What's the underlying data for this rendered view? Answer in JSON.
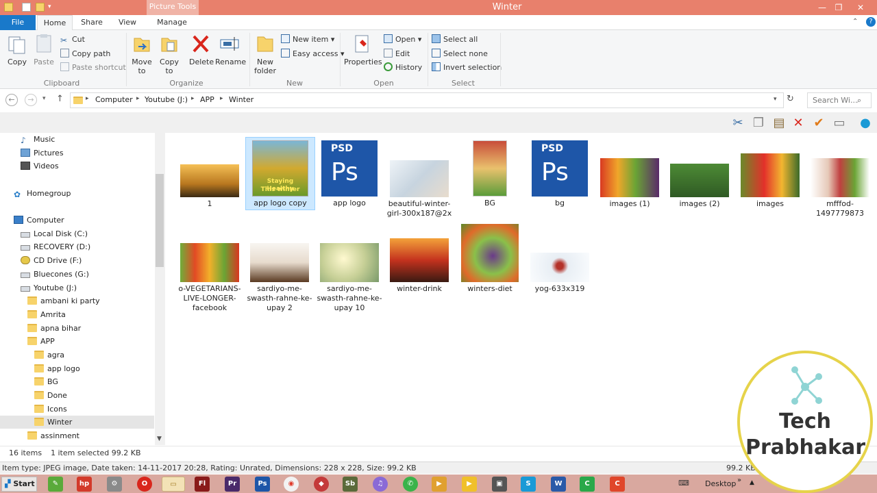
{
  "window": {
    "title": "Winter",
    "picture_tools": "Picture Tools"
  },
  "tabs": [
    "File",
    "Home",
    "Share",
    "View",
    "Manage"
  ],
  "ribbon": {
    "clipboard": {
      "copy": "Copy",
      "paste": "Paste",
      "cut": "Cut",
      "copy_path": "Copy path",
      "paste_shortcut": "Paste shortcut",
      "label": "Clipboard"
    },
    "organize": {
      "move_to": "Move to",
      "copy_to": "Copy to",
      "delete": "Delete",
      "rename": "Rename",
      "label": "Organize"
    },
    "new": {
      "new_folder": "New folder",
      "new_item": "New item",
      "easy_access": "Easy access",
      "label": "New"
    },
    "open": {
      "properties": "Properties",
      "open": "Open",
      "edit": "Edit",
      "history": "History",
      "label": "Open"
    },
    "select": {
      "select_all": "Select all",
      "select_none": "Select none",
      "invert": "Invert selection",
      "label": "Select"
    }
  },
  "address": {
    "crumbs": [
      "Computer",
      "Youtube (J:)",
      "APP",
      "Winter"
    ],
    "search_placeholder": "Search Wi..."
  },
  "nav": {
    "items": [
      "Music",
      "Pictures",
      "Videos",
      "Homegroup",
      "Computer",
      "Local Disk (C:)",
      "RECOVERY (D:)",
      "CD Drive (F:)",
      "Bluecones (G:)",
      "Youtube (J:)",
      "ambani ki party",
      "Amrita",
      "apna bihar",
      "APP",
      "agra",
      "app logo",
      "BG",
      "Done",
      "Icons",
      "Winter",
      "assinment"
    ]
  },
  "files": [
    {
      "name": "1"
    },
    {
      "name": "app logo copy"
    },
    {
      "name": "app logo"
    },
    {
      "name": "beautiful-winter-girl-300x187@2x"
    },
    {
      "name": "BG"
    },
    {
      "name": "bg"
    },
    {
      "name": "images (1)"
    },
    {
      "name": "images (2)"
    },
    {
      "name": "images"
    },
    {
      "name": "mfffod-1497779873"
    },
    {
      "name": "o-VEGETARIANS-LIVE-LONGER-facebook"
    },
    {
      "name": "sardiyo-me-swasth-rahne-ke-upay 2"
    },
    {
      "name": "sardiyo-me-swasth-rahne-ke-upay 10"
    },
    {
      "name": "winter-drink"
    },
    {
      "name": "winters-diet"
    },
    {
      "name": "yog-633x319"
    }
  ],
  "thumb_text": {
    "psd": "PSD",
    "ps": "Ps",
    "staying": "Staying Healthy",
    "this_winter": "This winter"
  },
  "status": {
    "items": "16 items",
    "selected": "1 item selected  99.2 KB",
    "size_right": "99.2 KB"
  },
  "details": "Item type: JPEG image, Date taken: 14-11-2017 20:28, Rating: Unrated, Dimensions: 228 x 228, Size: 99.2 KB",
  "taskbar": {
    "start": "Start",
    "desktop": "Desktop"
  },
  "logo": {
    "line1": "Tech",
    "line2": "Prabhakar"
  },
  "colors": {
    "titlebar": "#e8806c",
    "file_tab": "#1979ca",
    "selection": "#cce8ff"
  }
}
